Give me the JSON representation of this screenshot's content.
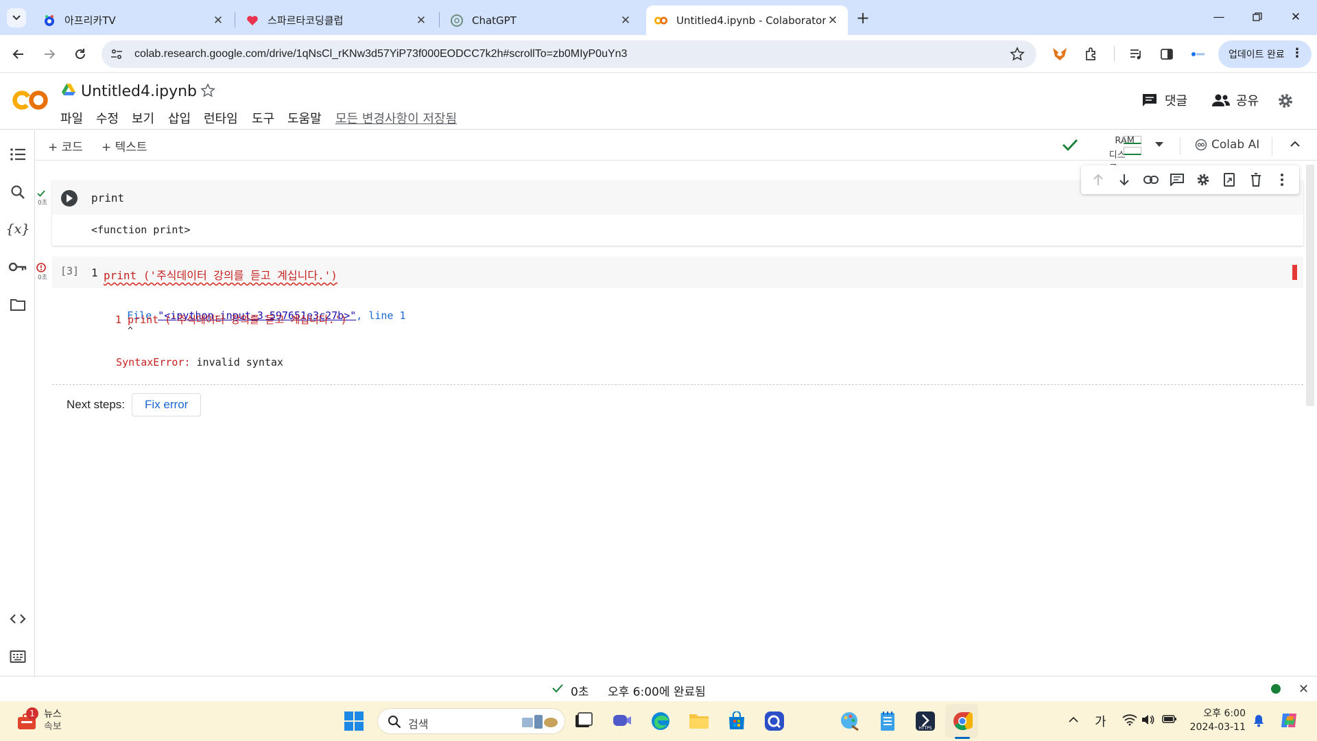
{
  "browser": {
    "tabs": [
      {
        "title": "아프리카TV",
        "active": false
      },
      {
        "title": "스파르타코딩클럽",
        "active": false
      },
      {
        "title": "ChatGPT",
        "active": false
      },
      {
        "title": "Untitled4.ipynb - Colaboratory",
        "active": true
      }
    ],
    "url": "colab.research.google.com/drive/1qNsCl_rKNw3d57YiP73f000EODCC7k2h#scrollTo=zb0MIyP0uYn3",
    "update_label": "업데이트 완료"
  },
  "colab": {
    "logo": "CO",
    "notebook_title": "Untitled4.ipynb",
    "menu": [
      "파일",
      "수정",
      "보기",
      "삽입",
      "런타임",
      "도구",
      "도움말"
    ],
    "save_status": "모든 변경사항이 저장됨",
    "comment_label": "댓글",
    "share_label": "공유",
    "add_code_label": "+ 코드",
    "add_text_label": "+ 텍스트",
    "ram_label": "RAM",
    "disk_label": "디스크",
    "colab_ai_label": "Colab AI"
  },
  "cells": [
    {
      "exec_time": "0초",
      "code": "print",
      "output": "<function print>"
    },
    {
      "exec_time": "0초",
      "exec_count": "[3]",
      "line_no": "1",
      "code": "print ('주식데이터 강의를 듣고 계십니다.')",
      "trace_file_prefix": "File ",
      "trace_file_link": "\"<ipython-input-3-597651e3c27b>\"",
      "trace_line_text": ", line 1",
      "trace_code": "1 print ('주식데이터 강의를 듣고 계십니다.')",
      "trace_caret": "^",
      "error_type": "SyntaxError:",
      "error_msg": " invalid syntax",
      "next_steps_label": "Next steps:",
      "fix_error_label": "Fix error"
    }
  ],
  "status": {
    "duration": "0초",
    "completed": "오후 6:00에 완료됨"
  },
  "taskbar": {
    "news_badge": "1",
    "news_line1": "뉴스",
    "news_line2": "속보",
    "search_placeholder": "검색",
    "ime": "가",
    "time": "오후 6:00",
    "date": "2024-03-11"
  },
  "colors": {
    "tabstrip": "#d3e3fd",
    "colab_orange": "#f9ab00",
    "error_red": "#c5221f",
    "link_blue": "#1a0dab",
    "success_green": "#188038",
    "taskbar": "#fbf4d8"
  }
}
